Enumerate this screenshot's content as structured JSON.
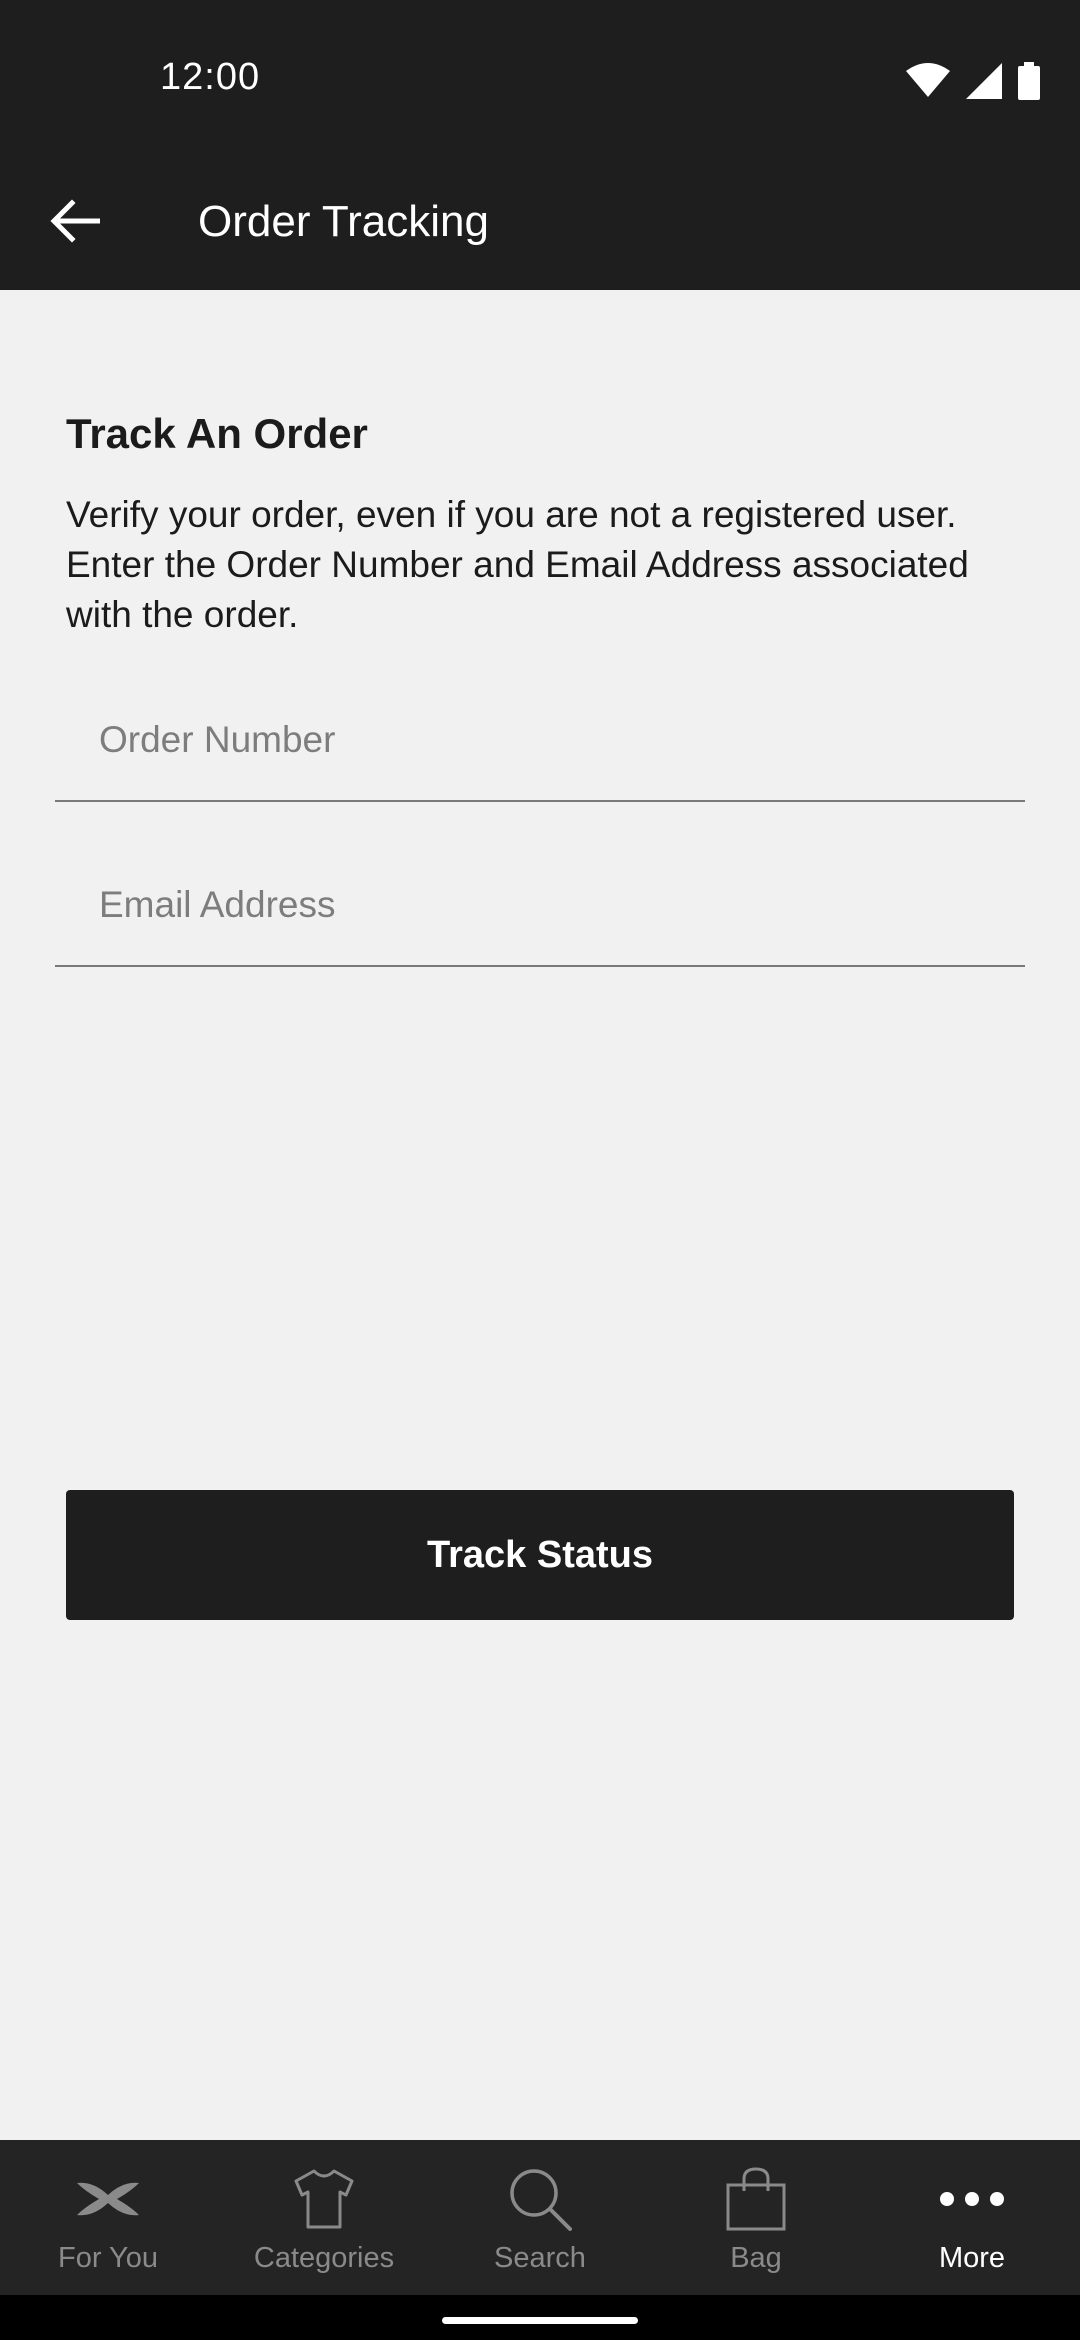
{
  "status_bar": {
    "time": "12:00",
    "icons": [
      "wifi-icon",
      "signal-icon",
      "battery-icon"
    ]
  },
  "app_bar": {
    "title": "Order Tracking",
    "back_icon": "arrow-left-icon"
  },
  "main": {
    "heading": "Track An Order",
    "description": "Verify your order, even if you are not a registered user. Enter the Order Number and Email Address associated with the order.",
    "order_number": {
      "value": "",
      "placeholder": "Order Number"
    },
    "email_address": {
      "value": "",
      "placeholder": "Email Address"
    },
    "track_button_label": "Track Status"
  },
  "bottom_nav": {
    "items": [
      {
        "label": "For You",
        "icon": "ua-logo-icon",
        "active": false
      },
      {
        "label": "Categories",
        "icon": "shirt-icon",
        "active": false
      },
      {
        "label": "Search",
        "icon": "search-icon",
        "active": false
      },
      {
        "label": "Bag",
        "icon": "bag-icon",
        "active": false
      },
      {
        "label": "More",
        "icon": "more-dots-icon",
        "active": true
      }
    ]
  },
  "colors": {
    "bar_background": "#1e1e1e",
    "page_background": "#f1f1f1",
    "nav_background": "#242424",
    "nav_inactive": "#8a8a8a",
    "nav_active": "#ffffff"
  }
}
